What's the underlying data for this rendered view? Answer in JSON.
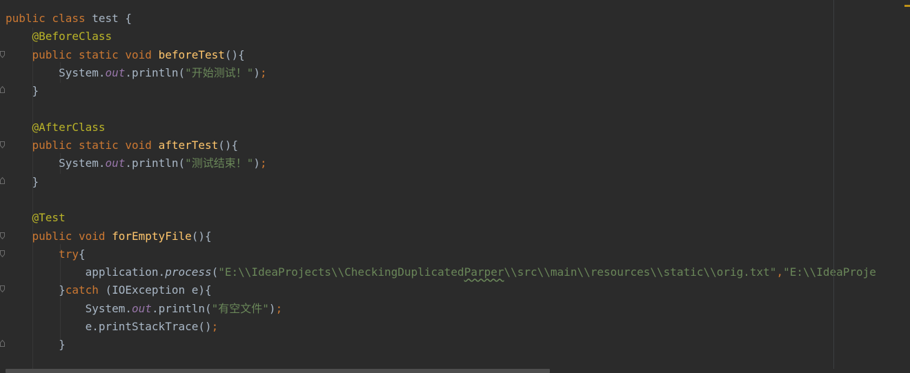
{
  "editor": {
    "language": "java",
    "colors": {
      "background": "#2b2b2b",
      "keyword": "#cc7832",
      "annotation": "#bbb529",
      "method_declaration": "#ffc66d",
      "static_field": "#9876aa",
      "string": "#6a8759",
      "plain": "#a9b7c6"
    },
    "lines": [
      [
        {
          "t": "public class ",
          "c": "kw"
        },
        {
          "t": "test {",
          "c": "pl"
        }
      ],
      [
        {
          "t": "    "
        },
        {
          "t": "@BeforeClass",
          "c": "ann"
        }
      ],
      [
        {
          "t": "    "
        },
        {
          "t": "public static void ",
          "c": "kw"
        },
        {
          "t": "beforeTest",
          "c": "fn"
        },
        {
          "t": "(){",
          "c": "pl"
        }
      ],
      [
        {
          "t": "        "
        },
        {
          "t": "System.",
          "c": "pl"
        },
        {
          "t": "out",
          "c": "fld"
        },
        {
          "t": ".println(",
          "c": "pl"
        },
        {
          "t": "\"开始测试！\"",
          "c": "str"
        },
        {
          "t": ")",
          "c": "pl"
        },
        {
          "t": ";",
          "c": "kw"
        }
      ],
      [
        {
          "t": "    "
        },
        {
          "t": "}",
          "c": "pl"
        }
      ],
      [
        {
          "t": ""
        }
      ],
      [
        {
          "t": "    "
        },
        {
          "t": "@AfterClass",
          "c": "ann"
        }
      ],
      [
        {
          "t": "    "
        },
        {
          "t": "public static void ",
          "c": "kw"
        },
        {
          "t": "afterTest",
          "c": "fn"
        },
        {
          "t": "(){",
          "c": "pl"
        }
      ],
      [
        {
          "t": "        "
        },
        {
          "t": "System.",
          "c": "pl"
        },
        {
          "t": "out",
          "c": "fld"
        },
        {
          "t": ".println(",
          "c": "pl"
        },
        {
          "t": "\"测试结束！\"",
          "c": "str"
        },
        {
          "t": ")",
          "c": "pl"
        },
        {
          "t": ";",
          "c": "kw"
        }
      ],
      [
        {
          "t": "    "
        },
        {
          "t": "}",
          "c": "pl"
        }
      ],
      [
        {
          "t": ""
        }
      ],
      [
        {
          "t": "    "
        },
        {
          "t": "@Test",
          "c": "ann"
        }
      ],
      [
        {
          "t": "    "
        },
        {
          "t": "public void ",
          "c": "kw"
        },
        {
          "t": "forEmptyFile",
          "c": "fn"
        },
        {
          "t": "(){",
          "c": "pl"
        }
      ],
      [
        {
          "t": "        "
        },
        {
          "t": "try",
          "c": "kw"
        },
        {
          "t": "{",
          "c": "pl"
        }
      ],
      [
        {
          "t": "            "
        },
        {
          "t": "application.",
          "c": "pl"
        },
        {
          "t": "process",
          "c": "pl call"
        },
        {
          "t": "(",
          "c": "pl"
        },
        {
          "t": "\"E:\\\\IdeaProjects\\\\CheckingDuplicated",
          "c": "str"
        },
        {
          "t": "Parper",
          "c": "str typo"
        },
        {
          "t": "\\\\src\\\\main\\\\resources\\\\static\\\\orig.txt\"",
          "c": "str"
        },
        {
          "t": ",",
          "c": "kw"
        },
        {
          "t": "\"E:\\\\IdeaProje",
          "c": "str"
        }
      ],
      [
        {
          "t": "        "
        },
        {
          "t": "}",
          "c": "pl"
        },
        {
          "t": "catch ",
          "c": "kw"
        },
        {
          "t": "(IOException e){",
          "c": "pl"
        }
      ],
      [
        {
          "t": "            "
        },
        {
          "t": "System.",
          "c": "pl"
        },
        {
          "t": "out",
          "c": "fld"
        },
        {
          "t": ".println(",
          "c": "pl"
        },
        {
          "t": "\"有空文件\"",
          "c": "str"
        },
        {
          "t": ")",
          "c": "pl"
        },
        {
          "t": ";",
          "c": "kw"
        }
      ],
      [
        {
          "t": "            "
        },
        {
          "t": "e.printStackTrace()",
          "c": "pl"
        },
        {
          "t": ";",
          "c": "kw"
        }
      ],
      [
        {
          "t": "        "
        },
        {
          "t": "}",
          "c": "pl"
        }
      ]
    ]
  }
}
